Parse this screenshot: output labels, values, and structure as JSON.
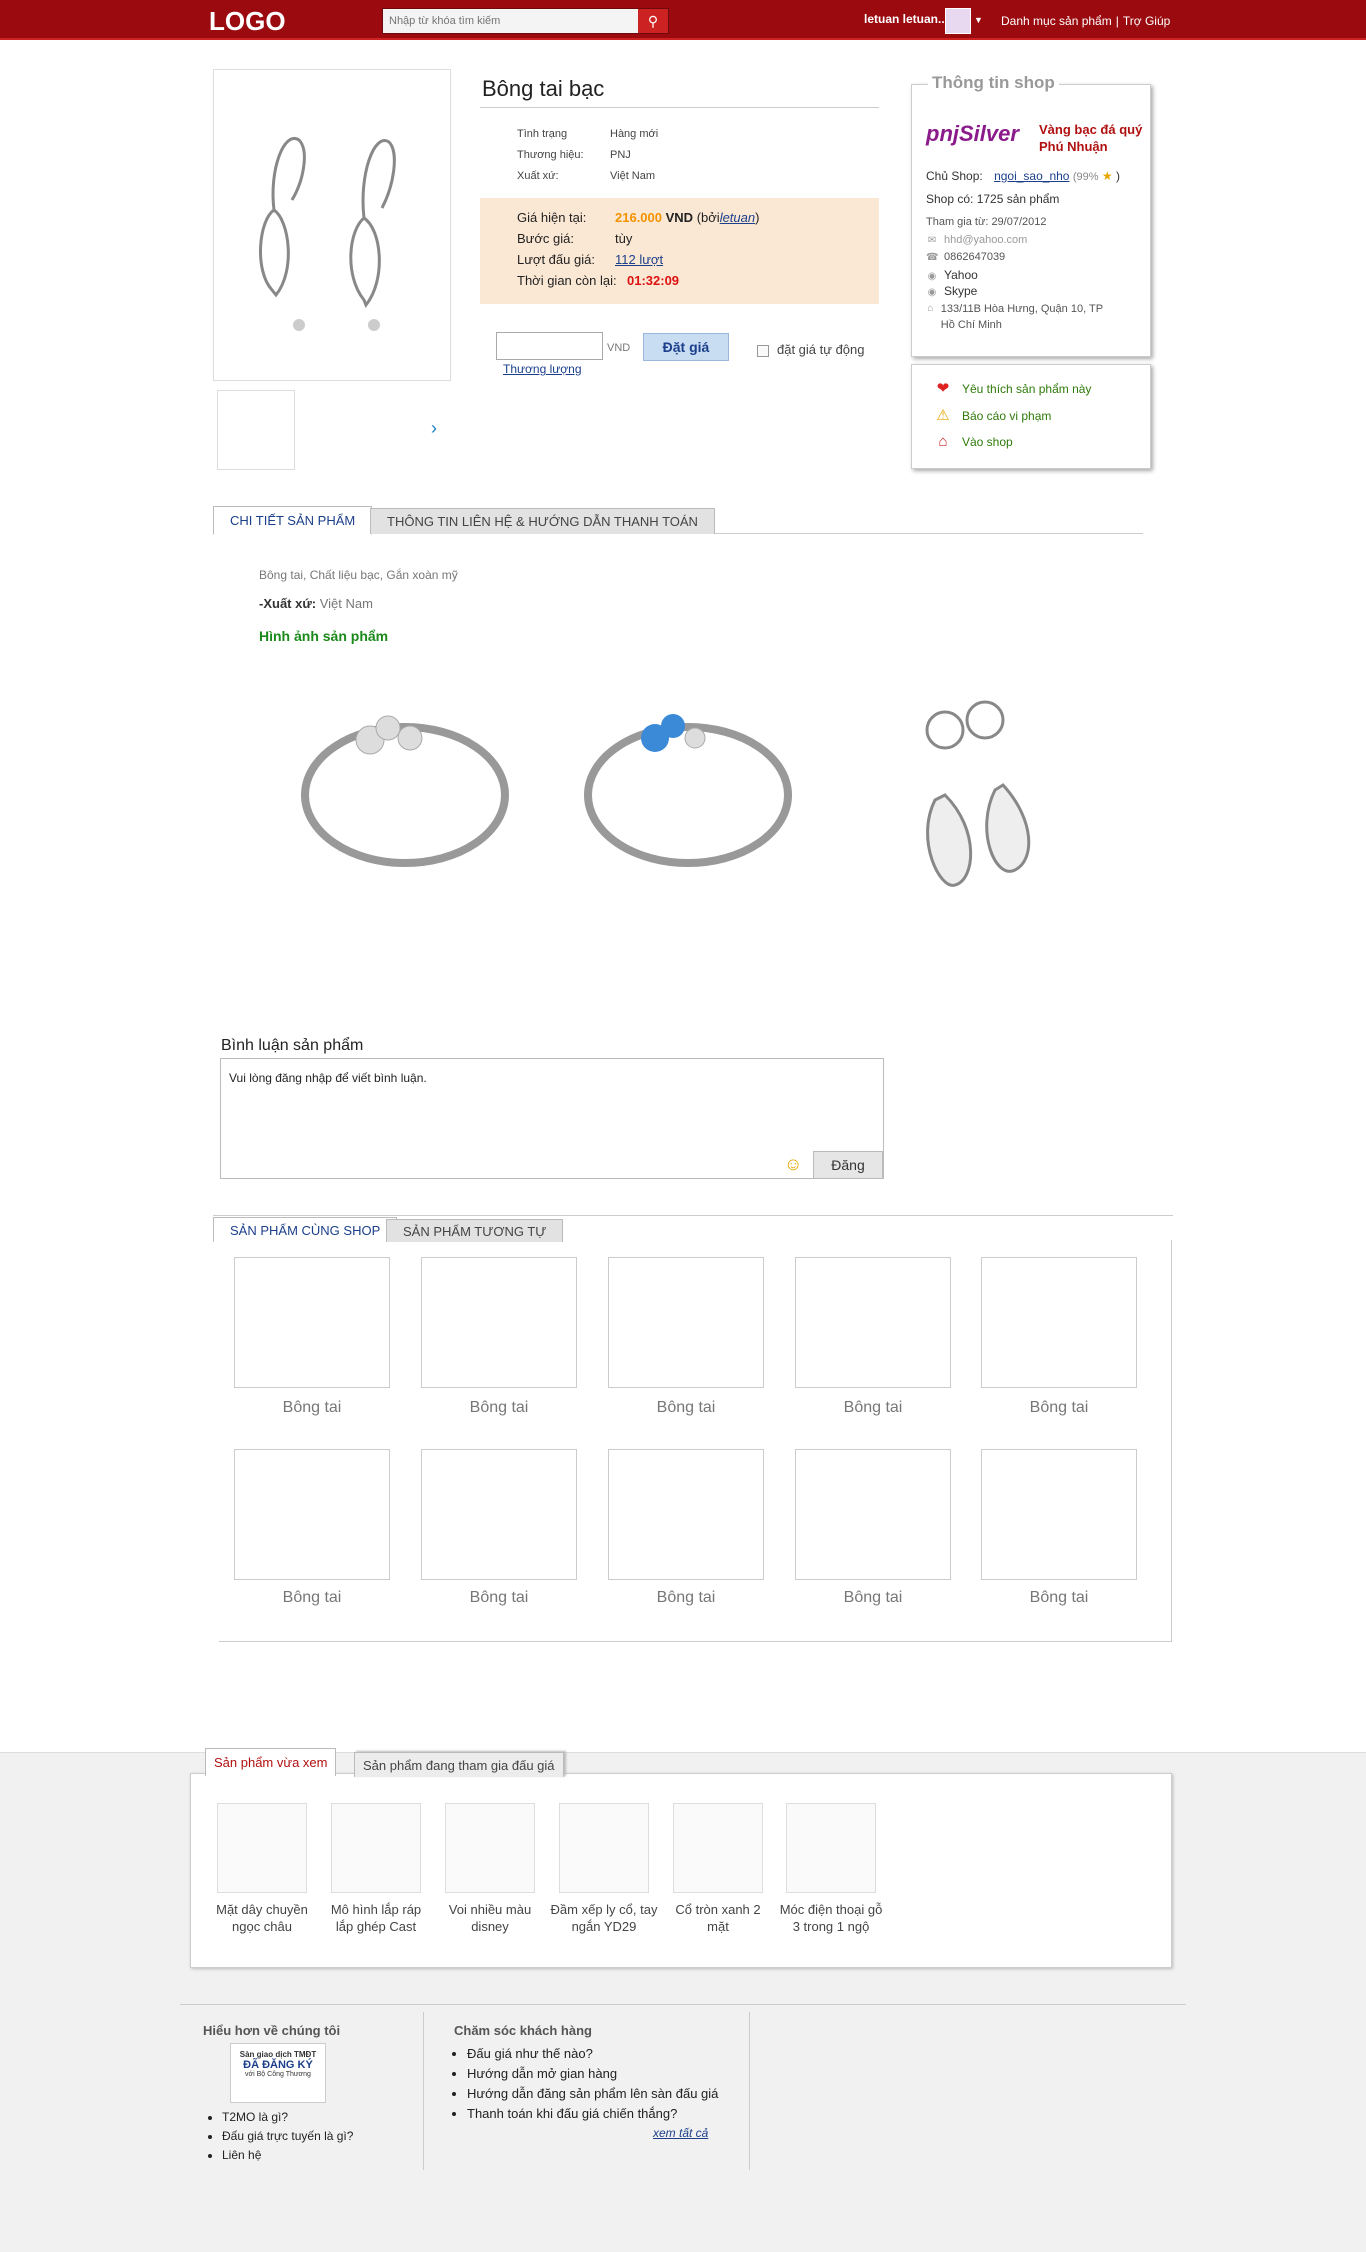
{
  "header": {
    "logo": "LOGO",
    "search_placeholder": "Nhập từ khóa tìm kiếm",
    "user": "letuan letuan...",
    "nav": [
      "Danh mục sản phẩm",
      "Trợ Giúp"
    ]
  },
  "product": {
    "title": "Bông tai bạc",
    "attrs": [
      {
        "k": "Tình trạng",
        "v": "Hàng mới"
      },
      {
        "k": "Thương hiệu:",
        "v": "PNJ"
      },
      {
        "k": "Xuất xứ:",
        "v": "Việt Nam"
      }
    ],
    "current_price_label": "Giá hiện tại:",
    "current_price": "216.000",
    "currency": "VND",
    "by_open": "(bởi",
    "bidder": "letuan",
    "by_close": ")",
    "step_label": "Bước giá:",
    "step_value": "tùy",
    "bids_label": "Lượt đấu giá:",
    "bids_value": "112 lượt",
    "time_label": "Thời gian còn lại:",
    "time_value": "01:32:09",
    "bid_unit": "VND",
    "bid_button": "Đặt giá",
    "negotiate": "Thương lượng",
    "autobid": "đặt giá tự động"
  },
  "shop": {
    "box_title": "Thông tin shop",
    "brand_logo": "pnjSilver",
    "name": "Vàng bạc đá quý Phú Nhuận",
    "owner_label": "Chủ Shop:",
    "owner": "ngoi_sao_nho",
    "rating": "(99%",
    "rating_close": ")",
    "product_count": "Shop có: 1725 sản phẩm",
    "joined": "Tham gia từ: 29/07/2012",
    "email": "hhd@yahoo.com",
    "phone": "0862647039",
    "yahoo": "Yahoo",
    "skype": "Skype",
    "address": "133/11B Hòa Hưng, Quận 10, TP Hồ Chí Minh"
  },
  "actions": [
    "Yêu thích sản phẩm này",
    "Báo cáo vi phạm",
    "Vào shop"
  ],
  "detail_tabs": [
    "CHI TIẾT SẢN PHẨM",
    "THÔNG TIN LIÊN HỆ & HƯỚNG DẪN THANH TOÁN"
  ],
  "detail": {
    "desc": "Bông tai, Chất liệu bạc, Gắn xoàn mỹ",
    "origin_label": "-Xuất xứ:",
    "origin_value": "Việt Nam",
    "images_title": "Hình ảnh sản phẩm"
  },
  "comments": {
    "title": "Bình luận sản phẩm",
    "placeholder": "Vui lòng đăng nhập để viết bình luận.",
    "post_button": "Đăng"
  },
  "related_tabs": [
    "SẢN PHẨM CÙNG SHOP",
    "SẢN PHẨM TƯƠNG TỰ"
  ],
  "related_items": [
    "Bông tai",
    "Bông tai",
    "Bông tai",
    "Bông tai",
    "Bông tai",
    "Bông tai",
    "Bông tai",
    "Bông tai",
    "Bông tai",
    "Bông tai"
  ],
  "recent_tabs": [
    "Sản phẩm vừa xem",
    "Sản phẩm đang tham gia đấu giá"
  ],
  "recent_items": [
    "Mặt dây chuyền ngọc châu",
    "Mô hình lắp ráp lắp ghép Cast",
    "Voi nhiều màu disney",
    "Đầm xếp ly cổ, tay ngắn YD29",
    "Cổ tròn xanh 2 mặt",
    "Móc điện thoại gỗ 3 trong 1 ngộ"
  ],
  "footer": {
    "col1_title": "Hiểu hơn về chúng tôi",
    "badge": [
      "Sàn giao dịch TMĐT",
      "ĐÃ ĐĂNG KÝ",
      "với Bộ Công Thương"
    ],
    "col1_links": [
      "T2MO là gì?",
      "Đấu giá trực tuyến là gì?",
      "Liên hệ"
    ],
    "col2_title": "Chăm sóc khách hàng",
    "col2_links": [
      "Đấu giá như thế nào?",
      "Hướng dẫn mở gian hàng",
      "Hướng dẫn đăng sản phẩm lên sàn đấu giá",
      "Thanh toán khi đấu giá chiến thắng?"
    ],
    "see_all": "xem tất cả"
  },
  "colors": {
    "brand_red": "#9a0a0f",
    "link_blue": "#1b3f8b",
    "price_orange": "#f39200",
    "bid_panel": "#fbe8d4"
  }
}
